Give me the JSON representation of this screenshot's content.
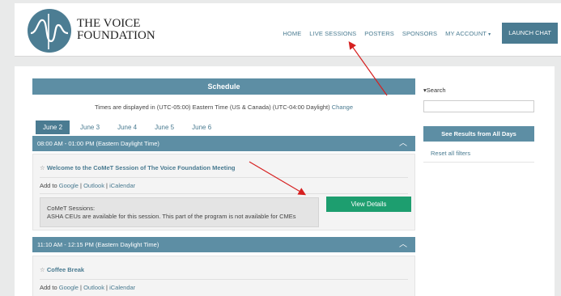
{
  "header": {
    "brand_line1": "THE VOICE",
    "brand_line2": "FOUNDATION",
    "nav": [
      {
        "label": "HOME"
      },
      {
        "label": "LIVE SESSIONS"
      },
      {
        "label": "POSTERS"
      },
      {
        "label": "SPONSORS"
      },
      {
        "label": "MY ACCOUNT"
      }
    ],
    "launch_label": "LAUNCH CHAT"
  },
  "schedule": {
    "title": "Schedule",
    "tz_text": "Times are displayed in (UTC-05:00) Eastern Time (US & Canada) (UTC-04:00 Daylight)",
    "change_label": "Change",
    "tabs": [
      "June 2",
      "June 3",
      "June 4",
      "June 5",
      "June 6"
    ],
    "active_tab": "June 2",
    "slots": [
      {
        "time": "08:00 AM - 01:00 PM (Eastern Daylight Time)",
        "session_title": "Welcome to the CoMeT Session of The Voice Foundation Meeting",
        "add_to": "Add to",
        "links": [
          "Google",
          "Outlook",
          "iCalendar"
        ],
        "info_line1": "CoMeT Sessions:",
        "info_line2": "ASHA CEUs are available for this session. This part of the program is not available for CMEs",
        "view_label": "View Details"
      },
      {
        "time": "11:10 AM - 12:15 PM (Eastern Daylight Time)",
        "session_title": "Coffee Break",
        "add_to": "Add to",
        "links": [
          "Google",
          "Outlook",
          "iCalendar"
        ]
      }
    ]
  },
  "sidebar": {
    "search_label": "Search",
    "search_value": "",
    "results_label": "See Results from All Days",
    "reset_label": "Reset all filters"
  },
  "colors": {
    "brand_teal": "#4a7b91",
    "bar_teal": "#5d8ea4",
    "view_green": "#1d9e6f",
    "annotation_red": "#d62020"
  },
  "icons": {
    "logo": "voice-waveform-logo",
    "star": "star-outline-icon",
    "chevron": "chevron-up-icon",
    "caret": "caret-down-icon"
  }
}
